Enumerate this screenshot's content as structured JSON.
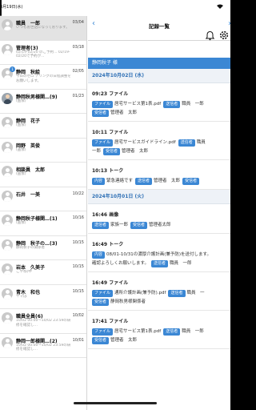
{
  "status": {
    "time": "3月19日(水)"
  },
  "main": {
    "title": "記録一覧",
    "patient": "静岡秋子 様"
  },
  "conversations": [
    {
      "name": "職員　一郎",
      "date": "03/04",
      "preview": "いつもお世話になっております。",
      "active": true,
      "photo": false,
      "badge": ""
    },
    {
      "name": "管理者(3)",
      "date": "03/18",
      "preview": "02/19-02/20 のご予約…  02/19-02/20で予約が…",
      "active": false,
      "photo": false,
      "badge": ""
    },
    {
      "name": "静岡　秋絵",
      "date": "02/05",
      "preview": "今日のゼロ テリングの日程調整をお願いします。",
      "active": false,
      "photo": false,
      "badge": "1"
    },
    {
      "name": "静岡秋男様関…(9)",
      "date": "01/23",
      "preview": "(画像)",
      "active": false,
      "photo": true,
      "badge": ""
    },
    {
      "name": "静岡　花子",
      "date": "",
      "preview": "(画像)",
      "active": false,
      "photo": false,
      "badge": ""
    },
    {
      "name": "岡野　英俊",
      "date": "",
      "preview": "(画像)",
      "active": false,
      "photo": false,
      "badge": ""
    },
    {
      "name": "相談員　太郎",
      "date": "",
      "preview": "(画像)",
      "active": false,
      "photo": false,
      "badge": ""
    },
    {
      "name": "石井　一美",
      "date": "10/22",
      "preview": "",
      "active": false,
      "photo": false,
      "badge": ""
    },
    {
      "name": "静岡秋子様関…(1)",
      "date": "10/16",
      "preview": "(画像)",
      "active": false,
      "photo": false,
      "badge": ""
    },
    {
      "name": "静岡　秋子の…(3)",
      "date": "10/15",
      "preview": "静岡秋子の関係者",
      "active": false,
      "photo": false,
      "badge": ""
    },
    {
      "name": "岩本　久美子",
      "date": "10/15",
      "preview": "こやね(中",
      "active": false,
      "photo": false,
      "badge": ""
    },
    {
      "name": "青木　和也",
      "date": "10/15",
      "preview": "ヤマは",
      "active": false,
      "photo": false,
      "badge": ""
    },
    {
      "name": "職員全員(6)",
      "date": "10/02",
      "preview": "10/02 00:00～10/02 23:59の研修を確認し…",
      "active": false,
      "photo": false,
      "badge": ""
    },
    {
      "name": "静岡一郎様関…(2)",
      "date": "10/01",
      "preview": "10/02 00:00～10/02 23:59の研修を確認し…",
      "active": false,
      "photo": false,
      "badge": ""
    }
  ],
  "feed": [
    {
      "kind": "date",
      "label": "2024年10月02日 (水)"
    },
    {
      "kind": "rec",
      "title": "09:23 ファイル",
      "rows": [
        [
          {
            "t": "tag",
            "v": "ファイル"
          },
          {
            "t": "val",
            "v": "居宅サービス第1表.pdf"
          },
          {
            "t": "tag",
            "v": "送信者"
          },
          {
            "t": "val",
            "v": "職員　一郎"
          }
        ],
        [
          {
            "t": "tag",
            "v": "受信者"
          },
          {
            "t": "val",
            "v": "管理者　太郎"
          }
        ]
      ]
    },
    {
      "kind": "rec",
      "title": "10:11 ファイル",
      "rows": [
        [
          {
            "t": "tag",
            "v": "ファイル"
          },
          {
            "t": "val",
            "v": "居宅サービスガイドライン.pdf"
          },
          {
            "t": "tag",
            "v": "送信者"
          },
          {
            "t": "val",
            "v": "職員"
          }
        ],
        [
          {
            "t": "val",
            "v": "一郎"
          },
          {
            "t": "tag",
            "v": "受信者"
          },
          {
            "t": "val",
            "v": "管理者　太郎"
          }
        ]
      ]
    },
    {
      "kind": "rec",
      "title": "10:13 トーク",
      "rows": [
        [
          {
            "t": "tag",
            "v": "内容"
          },
          {
            "t": "val",
            "v": "緊急連絡です"
          },
          {
            "t": "tag",
            "v": "送信者"
          },
          {
            "t": "val",
            "v": "管理者　太郎"
          },
          {
            "t": "tag",
            "v": "受信者"
          }
        ]
      ]
    },
    {
      "kind": "date",
      "label": "2024年10月01日 (火)"
    },
    {
      "kind": "rec",
      "title": "16:46 画像",
      "rows": [
        [
          {
            "t": "tag",
            "v": "送信者"
          },
          {
            "t": "val",
            "v": "家族一郎"
          },
          {
            "t": "tag",
            "v": "受信者"
          },
          {
            "t": "val",
            "v": "管理者太郎"
          }
        ]
      ]
    },
    {
      "kind": "rec",
      "title": "16:49 トーク",
      "rows": [
        [
          {
            "t": "tag",
            "v": "内容"
          },
          {
            "t": "val",
            "v": "08/01-10/31の濃厚介護計画(兼予防)を送付します。"
          }
        ],
        [
          {
            "t": "val",
            "v": "確認よろしくお願いします。"
          },
          {
            "t": "tag",
            "v": "送信者"
          },
          {
            "t": "val",
            "v": "職員　一郎"
          }
        ]
      ]
    },
    {
      "kind": "rec",
      "title": "16:49 ファイル",
      "rows": [
        [
          {
            "t": "tag",
            "v": "ファイル"
          },
          {
            "t": "val",
            "v": "通所介護計画(兼予防).pdf"
          },
          {
            "t": "tag",
            "v": "送信者"
          },
          {
            "t": "val",
            "v": "職員　一"
          }
        ],
        [
          {
            "t": "tag",
            "v": "受信者"
          },
          {
            "t": "val",
            "v": "静岡秋男様関係者"
          }
        ]
      ]
    },
    {
      "kind": "rec",
      "title": "17:41 ファイル",
      "rows": [
        [
          {
            "t": "tag",
            "v": "ファイル"
          },
          {
            "t": "val",
            "v": "居宅サービス第1表.pdf"
          },
          {
            "t": "tag",
            "v": "送信者"
          },
          {
            "t": "val",
            "v": "職員　一郎"
          }
        ],
        [
          {
            "t": "tag",
            "v": "受信者"
          },
          {
            "t": "val",
            "v": "管理者　太郎"
          }
        ]
      ]
    }
  ]
}
